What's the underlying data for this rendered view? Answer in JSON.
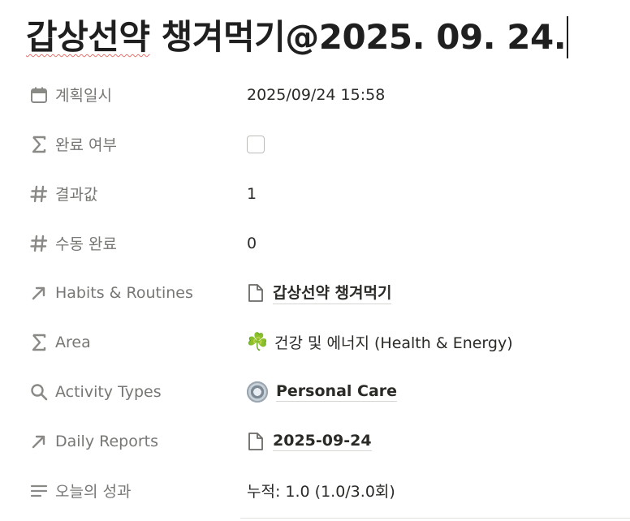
{
  "title": {
    "prefix": "갑상선약",
    "main": " 챙겨먹기",
    "date": "@2025. 09. 24."
  },
  "properties": [
    {
      "key": "계획일시",
      "icon": "calendar-icon",
      "value": "2025/09/24 15:58"
    },
    {
      "key": "완료 여부",
      "icon": "sigma-icon",
      "value": ""
    },
    {
      "key": "결과값",
      "icon": "hash-icon",
      "value": "1"
    },
    {
      "key": "수동 완료",
      "icon": "hash-icon",
      "value": "0"
    },
    {
      "key": "Habits & Routines",
      "icon": "arrow-northeast-icon",
      "value": "갑상선약 챙겨먹기",
      "value_icon": "page-icon"
    },
    {
      "key": "Area",
      "icon": "sigma-icon",
      "value": "건강 및 에너지 (Health & Energy)",
      "value_emoji": "☘️"
    },
    {
      "key": "Activity Types",
      "icon": "search-icon",
      "value": "Personal Care",
      "value_icon": "gear-icon"
    },
    {
      "key": "Daily Reports",
      "icon": "arrow-northeast-icon",
      "value": "2025-09-24",
      "value_icon": "page-icon"
    },
    {
      "key": "오늘의 성과",
      "icon": "text-lines-icon",
      "value": "누적: 1.0 (1.0/3.0회)"
    }
  ],
  "checkbox": {
    "checked": false
  },
  "colors": {
    "text": "#37352f",
    "muted": "#787774",
    "spellcheck": "#e0726a"
  }
}
